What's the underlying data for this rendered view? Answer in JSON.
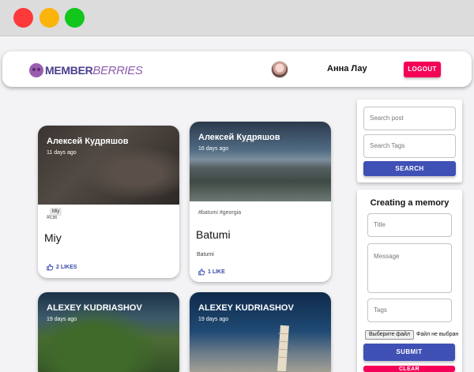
{
  "window": {
    "controls": [
      "close",
      "minimize",
      "maximize"
    ]
  },
  "header": {
    "logo_member": "MEMBER",
    "logo_berries": "BERRIES",
    "user_name": "Анна Лау",
    "logout_label": "LOGOUT"
  },
  "posts": [
    {
      "author": "Алексей Кудряшов",
      "time": "11 days ago",
      "tags": "#cat",
      "title": "Miy",
      "message": "",
      "likes": "2 LIKES",
      "tooltip": "Miy"
    },
    {
      "author": "Алексей Кудряшов",
      "time": "16 days ago",
      "tags": "#batumi #georgia",
      "title": "Batumi",
      "message": "Batumi",
      "likes": "1 LIKE"
    },
    {
      "author": "ALEXEY KUDRIASHOV",
      "time": "19 days ago"
    },
    {
      "author": "ALEXEY KUDRIASHOV",
      "time": "19 days ago"
    }
  ],
  "search": {
    "post_placeholder": "Search post",
    "tags_placeholder": "Search Tags",
    "button_label": "SEARCH"
  },
  "form": {
    "title": "Creating a memory",
    "title_placeholder": "Title",
    "message_placeholder": "Message",
    "tags_placeholder": "Tags",
    "file_button": "Выберите файл",
    "file_status": "Файл не выбран",
    "submit_label": "SUBMIT",
    "clear_label": "CLEAR"
  },
  "colors": {
    "primary": "#3f51b5",
    "secondary": "#f50057",
    "logo_purple": "#8f5cae"
  }
}
